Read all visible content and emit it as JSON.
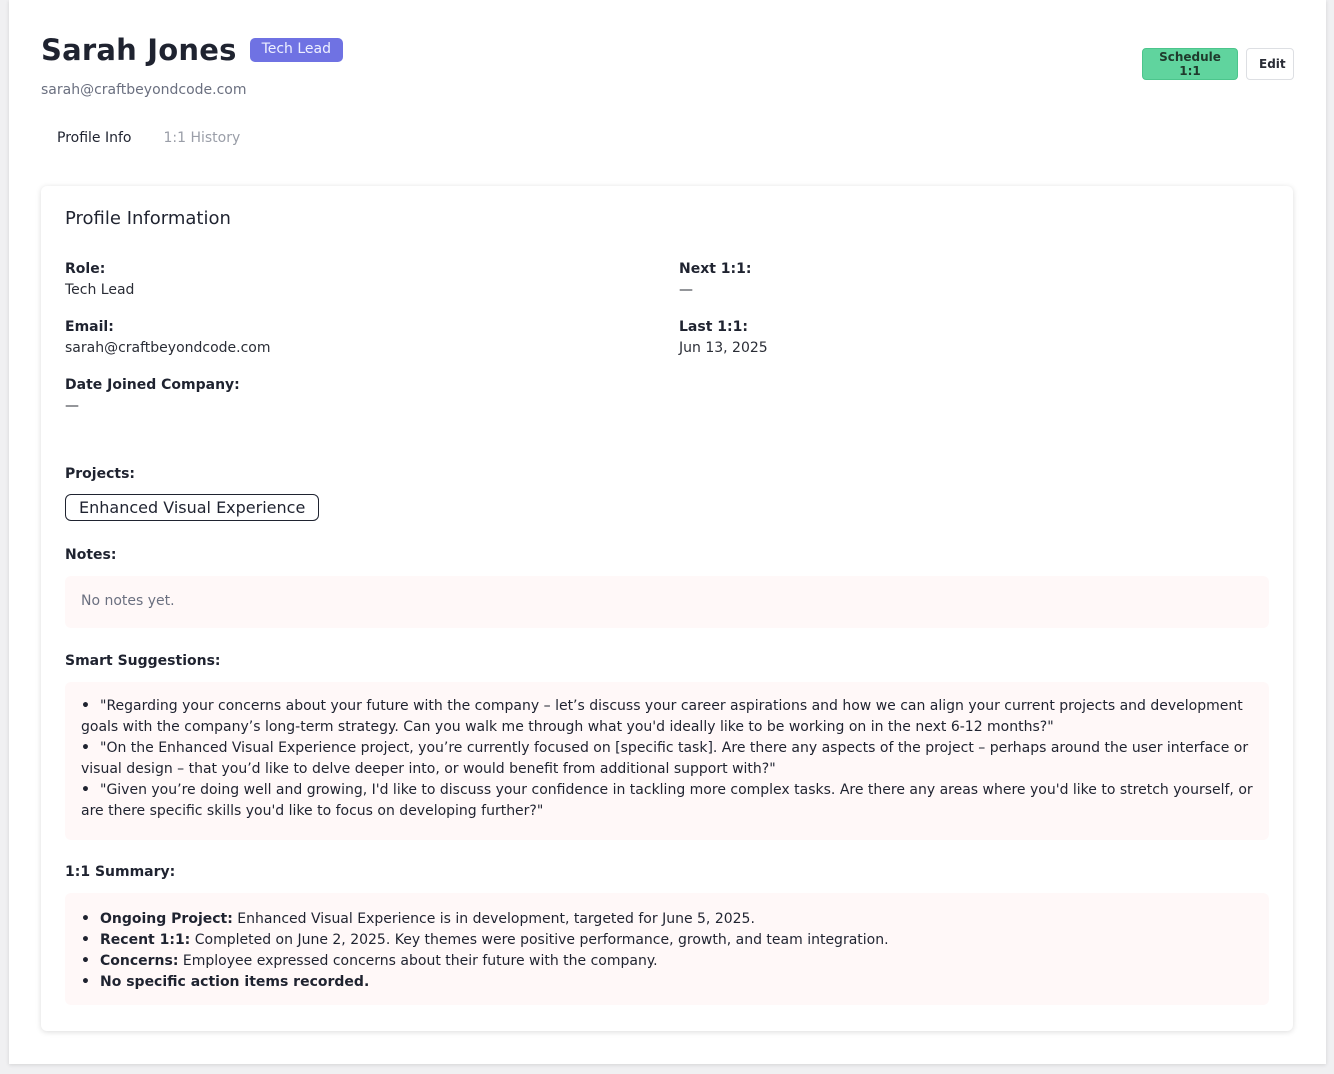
{
  "header": {
    "name": "Sarah Jones",
    "role_badge": "Tech Lead",
    "email": "sarah@craftbeyondcode.com",
    "schedule_button": "Schedule 1:1",
    "edit_button": "Edit"
  },
  "tabs": [
    {
      "label": "Profile Info",
      "active": true
    },
    {
      "label": "1:1 History",
      "active": false
    }
  ],
  "profile": {
    "title": "Profile Information",
    "role_label": "Role:",
    "role_value": "Tech Lead",
    "email_label": "Email:",
    "email_value": "sarah@craftbeyondcode.com",
    "joined_label": "Date Joined Company:",
    "joined_value": "—",
    "next_label": "Next 1:1:",
    "next_value": "—",
    "last_label": "Last 1:1:",
    "last_value": "Jun 13, 2025",
    "projects_label": "Projects:",
    "projects": [
      "Enhanced Visual Experience"
    ],
    "notes_label": "Notes:",
    "notes_value": "No notes yet.",
    "suggestions_label": "Smart Suggestions:",
    "suggestions": [
      "\"Regarding your concerns about your future with the company – let’s discuss your career aspirations and how we can align your current projects and development goals with the company’s long-term strategy. Can you walk me through what you'd ideally like to be working on in the next 6-12 months?\"",
      "\"On the Enhanced Visual Experience project, you’re currently focused on [specific task]. Are there any aspects of the project – perhaps around the user interface or visual design – that you’d like to delve deeper into, or would benefit from additional support with?\"",
      "\"Given you’re doing well and growing, I'd like to discuss your confidence in tackling more complex tasks. Are there any areas where you'd like to stretch yourself, or are there specific skills you'd like to focus on developing further?\""
    ],
    "summary_label": "1:1 Summary:",
    "summary": [
      {
        "bold": "Ongoing Project:",
        "text": " Enhanced Visual Experience is in development, targeted for June 5, 2025."
      },
      {
        "bold": "Recent 1:1:",
        "text": " Completed on June 2, 2025. Key themes were positive performance, growth, and team integration."
      },
      {
        "bold": "Concerns:",
        "text": " Employee expressed concerns about their future with the company."
      },
      {
        "bold": "No specific action items recorded.",
        "text": ""
      }
    ]
  },
  "colors": {
    "badge": "#6f72e3",
    "schedule_button": "#60d49e",
    "box_background": "#fff8f8"
  }
}
